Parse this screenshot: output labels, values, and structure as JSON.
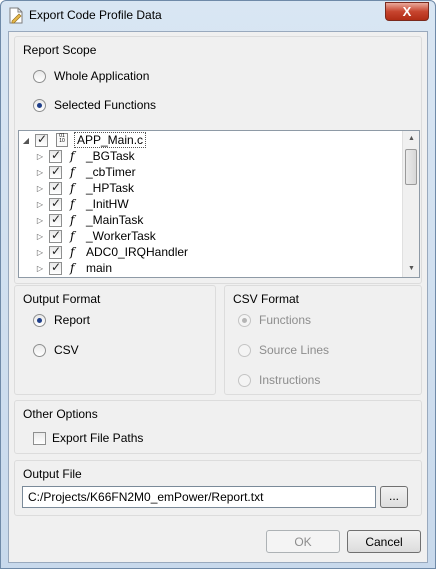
{
  "window": {
    "title": "Export Code Profile Data",
    "close_label": "X"
  },
  "report_scope": {
    "title": "Report Scope",
    "options": [
      {
        "label": "Whole Application",
        "selected": false
      },
      {
        "label": "Selected Functions",
        "selected": true
      }
    ]
  },
  "tree": {
    "root": {
      "label": "APP_Main.c",
      "checked": true,
      "expanded": true
    },
    "items": [
      {
        "label": "_BGTask",
        "checked": true
      },
      {
        "label": "_cbTimer",
        "checked": true
      },
      {
        "label": "_HPTask",
        "checked": true
      },
      {
        "label": "_InitHW",
        "checked": true
      },
      {
        "label": "_MainTask",
        "checked": true
      },
      {
        "label": "_WorkerTask",
        "checked": true
      },
      {
        "label": "ADC0_IRQHandler",
        "checked": true
      },
      {
        "label": "main",
        "checked": true
      }
    ]
  },
  "output_format": {
    "title": "Output Format",
    "options": [
      {
        "label": "Report",
        "selected": true
      },
      {
        "label": "CSV",
        "selected": false
      }
    ]
  },
  "csv_format": {
    "title": "CSV Format",
    "enabled": false,
    "options": [
      {
        "label": "Functions",
        "selected": true
      },
      {
        "label": "Source Lines",
        "selected": false
      },
      {
        "label": "Instructions",
        "selected": false
      }
    ]
  },
  "other_options": {
    "title": "Other Options",
    "export_file_paths": {
      "label": "Export File Paths",
      "checked": false
    }
  },
  "output_file": {
    "title": "Output File",
    "path": "C:/Projects/K66FN2M0_emPower/Report.txt",
    "browse_label": "..."
  },
  "buttons": {
    "ok_label": "OK",
    "ok_enabled": false,
    "cancel_label": "Cancel"
  }
}
